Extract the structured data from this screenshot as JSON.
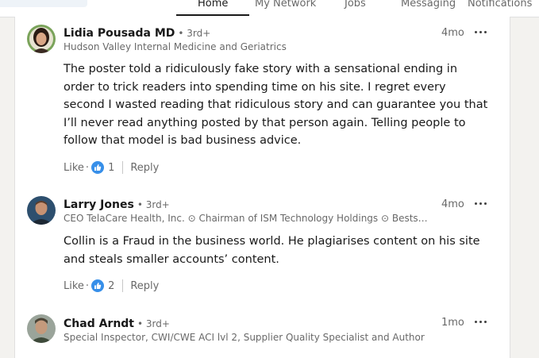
{
  "nav": {
    "items": [
      {
        "label": "Home",
        "active": true
      },
      {
        "label": "My Network",
        "active": false
      },
      {
        "label": "Jobs",
        "active": false
      },
      {
        "label": "Messaging",
        "active": false
      },
      {
        "label": "Notifications",
        "active": false
      }
    ]
  },
  "comments": [
    {
      "author": "Lidia Pousada MD",
      "degree": "• 3rd+",
      "headline": "Hudson Valley Internal Medicine and Geriatrics",
      "time": "4mo",
      "text": "The poster told a ridiculously fake story with a sensational ending in order to trick readers into spending time on his site. I regret every second I wasted reading that ridiculous story and can guarantee you that I’ll never read anything posted by that person again. Telling people to follow that model is bad business advice.",
      "like_label": "Like",
      "reaction_count": "1",
      "reply_label": "Reply"
    },
    {
      "author": "Larry Jones",
      "degree": "• 3rd+",
      "headline": "CEO TelaCare Health, Inc. ⊙ Chairman of ISM Technology Holdings ⊙ Bests…",
      "time": "4mo",
      "text": "Collin is a Fraud in the business world. He plagiarises content on his site and steals smaller accounts’ content.",
      "like_label": "Like",
      "reaction_count": "2",
      "reply_label": "Reply"
    },
    {
      "author": "Chad Arndt",
      "degree": "• 3rd+",
      "headline": "Special Inspector, CWI/CWE ACI lvl 2, Supplier Quality Specialist and Author",
      "time": "1mo"
    }
  ],
  "colors": {
    "page_bg": "#f3f2ef",
    "card_bg": "#ffffff",
    "like_blue": "#378fe9"
  },
  "icons": {
    "reaction": "thumbs-up-icon",
    "more": "ellipsis-icon"
  }
}
